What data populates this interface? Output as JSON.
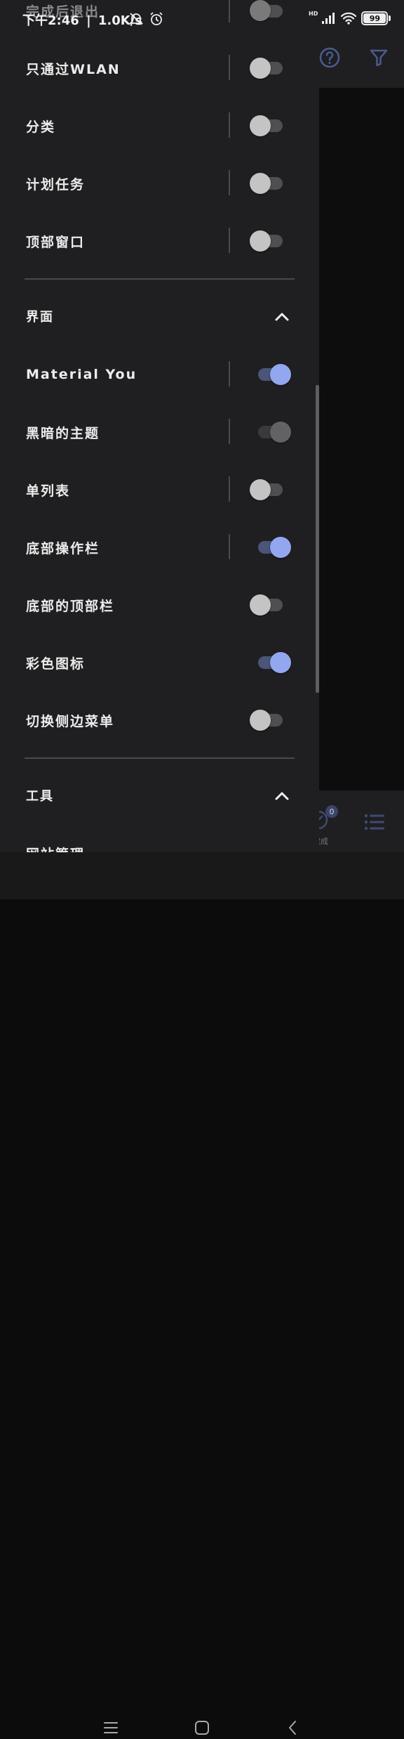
{
  "status_bar": {
    "time": "下午2:46",
    "speed": "1.0K/s",
    "network": "HD",
    "battery": "99"
  },
  "drawer": {
    "ghost_item": "完成后退出",
    "group1": [
      {
        "label": "只通过WLAN",
        "state": "off"
      },
      {
        "label": "分类",
        "state": "off"
      },
      {
        "label": "计划任务",
        "state": "off"
      },
      {
        "label": "顶部窗口",
        "state": "off"
      }
    ],
    "section_interface": {
      "title": "界面"
    },
    "group2": [
      {
        "label": "Material You",
        "state": "on"
      },
      {
        "label": "黑暗的主题",
        "state": "on-disabled"
      },
      {
        "label": "单列表",
        "state": "off"
      },
      {
        "label": "底部操作栏",
        "state": "on"
      },
      {
        "label": "底部的顶部栏",
        "state": "off"
      },
      {
        "label": "彩色图标",
        "state": "on"
      },
      {
        "label": "切换侧边菜单",
        "state": "off"
      }
    ],
    "section_tools": {
      "title": "工具"
    },
    "tools_items": [
      {
        "label": "网站管理"
      }
    ]
  },
  "background_app": {
    "badge_count": "0",
    "completed_label": "完成"
  },
  "colors": {
    "accent": "#93a7ee",
    "drawer_bg": "#1f1f21",
    "switch_off_thumb": "#c4c4c4"
  }
}
